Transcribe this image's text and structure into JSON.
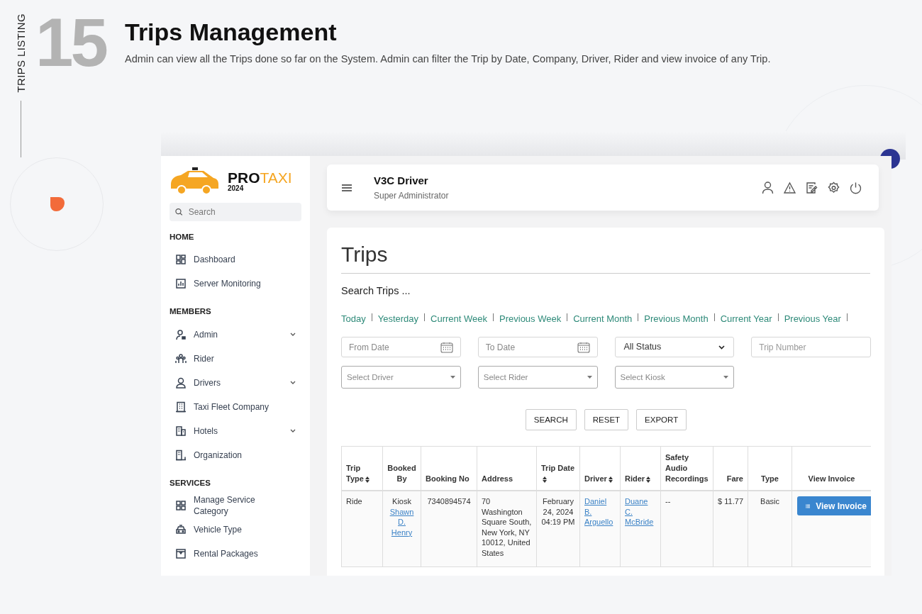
{
  "intro": {
    "side_label": "TRIPS LISTING",
    "number": "15",
    "title": "Trips Management",
    "description": "Admin can view all the Trips done so far on the System. Admin can filter the Trip by Date, Company, Driver, Rider and view invoice of any Trip."
  },
  "sidebar": {
    "brand_a": "PRO",
    "brand_b": "TAXI",
    "year": "2024",
    "search_placeholder": "Search",
    "sections": [
      {
        "heading": "HOME",
        "items": [
          {
            "label": "Dashboard",
            "expandable": false
          },
          {
            "label": "Server Monitoring",
            "expandable": false
          }
        ]
      },
      {
        "heading": "MEMBERS",
        "items": [
          {
            "label": "Admin",
            "expandable": true
          },
          {
            "label": "Rider",
            "expandable": false
          },
          {
            "label": "Drivers",
            "expandable": true
          },
          {
            "label": "Taxi Fleet Company",
            "expandable": false
          },
          {
            "label": "Hotels",
            "expandable": true
          },
          {
            "label": "Organization",
            "expandable": false
          }
        ]
      },
      {
        "heading": "SERVICES",
        "items": [
          {
            "label": "Manage Service Category",
            "expandable": false
          },
          {
            "label": "Vehicle Type",
            "expandable": false
          },
          {
            "label": "Rental Packages",
            "expandable": false
          }
        ]
      }
    ]
  },
  "topbar": {
    "name": "V3C Driver",
    "role": "Super Administrator"
  },
  "page": {
    "title": "Trips",
    "search_heading": "Search Trips ...",
    "quick_filters": [
      "Today",
      "Yesterday",
      "Current Week",
      "Previous Week",
      "Current Month",
      "Previous Month",
      "Current Year",
      "Previous Year"
    ],
    "filters": [
      {
        "kind": "date",
        "placeholder": "From Date"
      },
      {
        "kind": "date",
        "placeholder": "To Date"
      },
      {
        "kind": "select",
        "value": "All Status"
      },
      {
        "kind": "text",
        "placeholder": "Trip Number"
      },
      {
        "kind": "combo",
        "placeholder": "Select Driver"
      },
      {
        "kind": "combo",
        "placeholder": "Select Rider"
      },
      {
        "kind": "combo",
        "placeholder": "Select Kiosk"
      }
    ],
    "buttons": [
      "SEARCH",
      "RESET",
      "EXPORT"
    ],
    "table": {
      "columns": [
        {
          "label": "Trip Type",
          "sortable": true
        },
        {
          "label": "Booked By",
          "sortable": false
        },
        {
          "label": "Booking No",
          "sortable": false
        },
        {
          "label": "Address",
          "sortable": false
        },
        {
          "label": "Trip Date",
          "sortable": true
        },
        {
          "label": "Driver",
          "sortable": true
        },
        {
          "label": "Rider",
          "sortable": true
        },
        {
          "label": "Safety Audio Recordings",
          "sortable": false
        },
        {
          "label": "Fare",
          "sortable": false
        },
        {
          "label": "Type",
          "sortable": false
        },
        {
          "label": "View Invoice",
          "sortable": false
        }
      ],
      "rows": [
        {
          "trip_type": "Ride",
          "booked_via": "Kiosk",
          "booked_by": "Shawn D. Henry",
          "booking_no": "7340894574",
          "address": "70 Washington Square South, New York, NY 10012, United States",
          "trip_date": "February 24, 2024 04:19 PM",
          "driver": "Daniel B. Arguello",
          "rider": "Duane C. McBride",
          "safety": "--",
          "fare": "$ 11.77",
          "type": "Basic",
          "invoice": "View Invoice"
        }
      ]
    }
  }
}
